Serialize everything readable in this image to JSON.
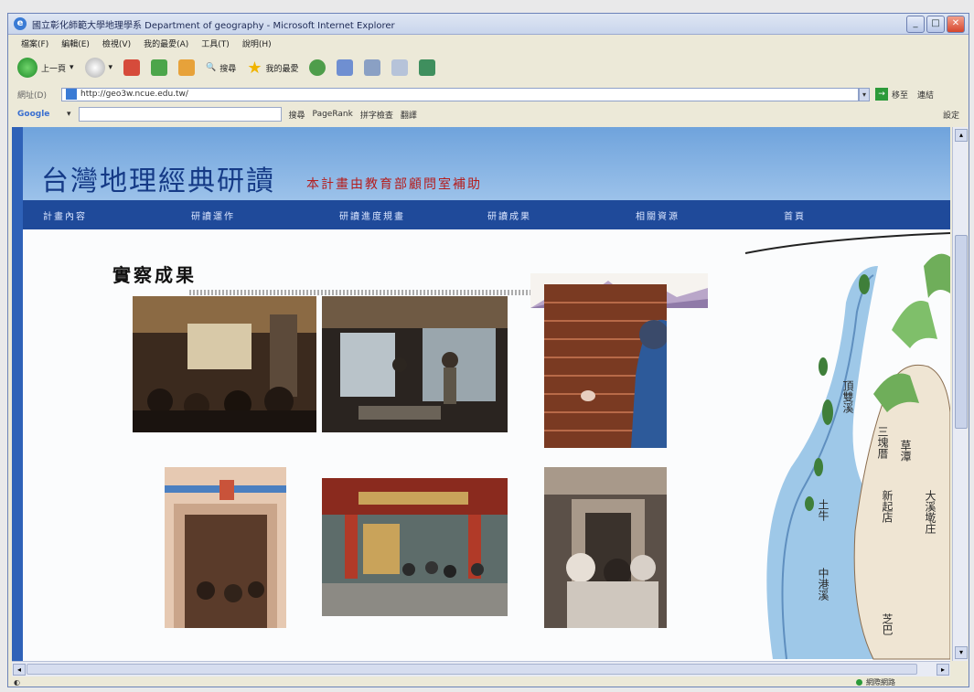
{
  "window": {
    "title": "國立彰化師範大學地理學系 Department of geography - Microsoft Internet Explorer"
  },
  "menu": [
    "檔案(F)",
    "編輯(E)",
    "檢視(V)",
    "我的最愛(A)",
    "工具(T)",
    "說明(H)"
  ],
  "toolbar": {
    "back_label": "上一頁",
    "search_label": "搜尋",
    "favorites_label": "我的最愛"
  },
  "address": {
    "label": "網址(D)",
    "url": "http://geo3w.ncue.edu.tw/",
    "go_label": "移至",
    "links_label": "連結"
  },
  "google": {
    "logo": "Google",
    "search_label": "搜尋",
    "page_rank_label": "PageRank",
    "spell_label": "拼字檢查",
    "translate_label": "翻譯",
    "settings_label": "設定"
  },
  "site": {
    "title": "台灣地理經典研讀",
    "subtitle": "本計畫由教育部顧問室補助",
    "nav": [
      "計畫內容",
      "研讀運作",
      "研讀進度規畫",
      "研讀成果",
      "相關資源",
      "首頁"
    ],
    "section_title": "實察成果"
  },
  "map": {
    "labels": [
      "頂雙溪",
      "三塊厝",
      "草潭",
      "新起店",
      "大溪墘庄",
      "土牛",
      "中港溪",
      "芝巴"
    ]
  },
  "photos": [
    {
      "name": "temple-interior-photo",
      "colors": [
        "#3b2a1e",
        "#8b6a44",
        "#d8c9a8"
      ]
    },
    {
      "name": "exhibit-hall-photo",
      "colors": [
        "#2a2420",
        "#6f5a44",
        "#b9c3c9"
      ]
    },
    {
      "name": "brick-wall-photo",
      "colors": [
        "#7a3a22",
        "#b86a48",
        "#2d5a9a"
      ]
    },
    {
      "name": "doorway-photo",
      "colors": [
        "#5a3b2a",
        "#caa58a",
        "#e6c9b2"
      ]
    },
    {
      "name": "temple-gate-photo",
      "colors": [
        "#8a2a1e",
        "#c9a35a",
        "#5d6c6a"
      ]
    },
    {
      "name": "stone-gate-photo",
      "colors": [
        "#5b5048",
        "#a8998a",
        "#e7dfd6"
      ]
    }
  ],
  "status": {
    "zone": "網際網路"
  }
}
